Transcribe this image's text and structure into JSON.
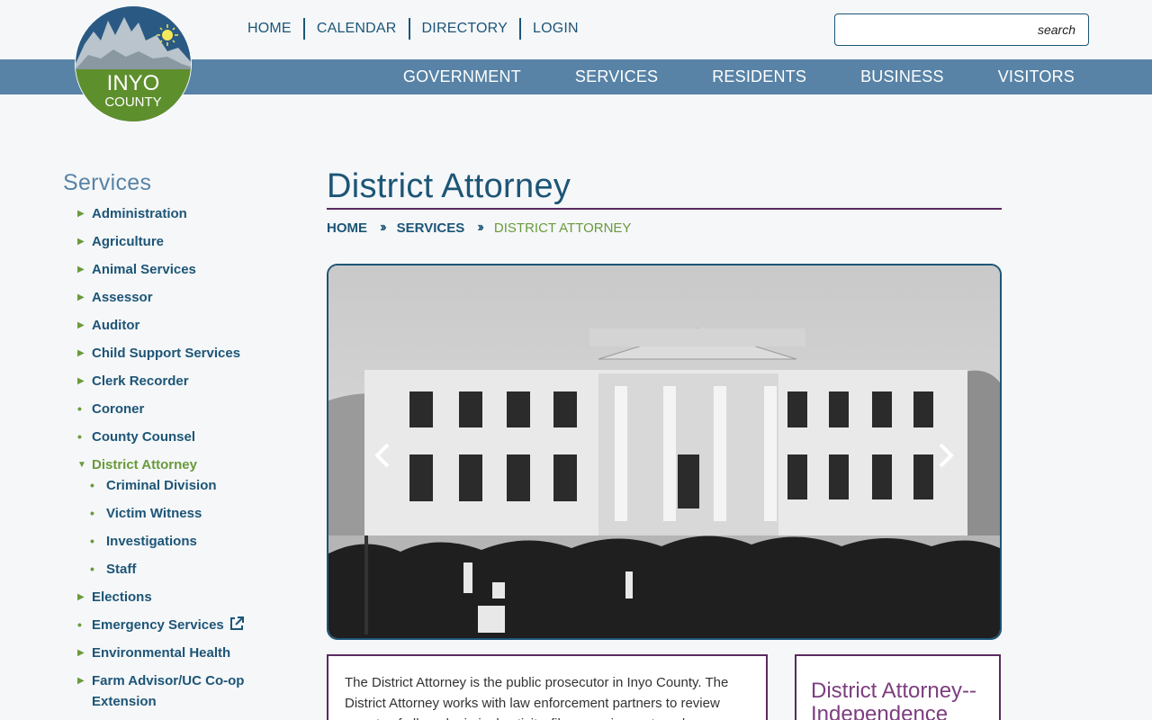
{
  "logo": {
    "line1": "INYO",
    "line2": "COUNTY"
  },
  "topnav": [
    "HOME",
    "CALENDAR",
    "DIRECTORY",
    "LOGIN"
  ],
  "search": {
    "placeholder": "search"
  },
  "mainnav": [
    "GOVERNMENT",
    "SERVICES",
    "RESIDENTS",
    "BUSINESS",
    "VISITORS"
  ],
  "sidebar": {
    "title": "Services",
    "items": [
      {
        "label": "Administration"
      },
      {
        "label": "Agriculture"
      },
      {
        "label": "Animal Services"
      },
      {
        "label": "Assessor"
      },
      {
        "label": "Auditor"
      },
      {
        "label": "Child Support Services"
      },
      {
        "label": "Clerk Recorder"
      },
      {
        "label": "Coroner"
      },
      {
        "label": "County Counsel"
      },
      {
        "label": "District Attorney"
      },
      {
        "label": "Criminal Division"
      },
      {
        "label": "Victim Witness"
      },
      {
        "label": "Investigations"
      },
      {
        "label": "Staff"
      },
      {
        "label": "Elections"
      },
      {
        "label": "Emergency Services"
      },
      {
        "label": "Environmental Health"
      },
      {
        "label": "Farm Advisor/UC Co-op Extension"
      }
    ]
  },
  "page": {
    "title": "District Attorney",
    "breadcrumb": [
      "HOME",
      "SERVICES",
      "DISTRICT ATTORNEY"
    ]
  },
  "intro": "The District Attorney is the public prosecutor in Inyo County. The District Attorney works with law enforcement partners to review reports of alleged criminal activity, file cases in court, and",
  "sidebox": {
    "title": "District Attorney-- Independence"
  },
  "colors": {
    "navy": "#1d5576",
    "steel": "#5883a6",
    "green": "#6a9a3a",
    "plum": "#5a2a5e"
  }
}
